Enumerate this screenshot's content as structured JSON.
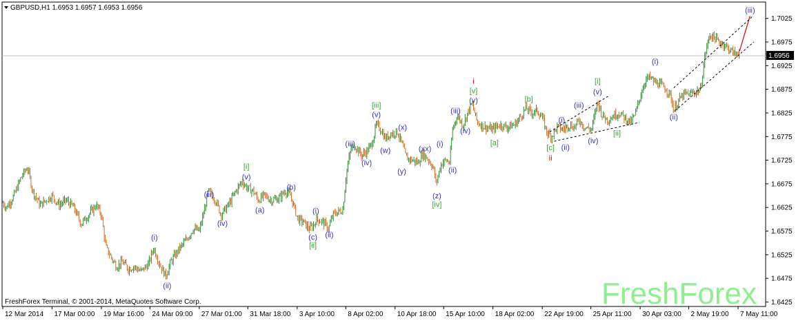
{
  "header": {
    "symbol_line": "GBPUSD,H1  1.6953 1.6957 1.6953 1.6956",
    "menu_arrow_icon": "triangle-down-icon"
  },
  "footer": {
    "copyright": "FreshForex Terminal, © 2001-2014, MetaQuotes Software Corp.",
    "watermark": "FreshForex"
  },
  "colors": {
    "background": "#ffffff",
    "axes": "#000000",
    "bull_candle": "#2e8b2e",
    "bear_candle": "#d2691e",
    "wave_blue": "#3333cc",
    "wave_green": "#33aa33",
    "wave_red": "#dd0000",
    "watermark": "#90ee90",
    "price_line": "#c0c0c0",
    "price_label_bg": "#000000",
    "price_label_fg": "#ffffff"
  },
  "chart_data": {
    "type": "candlestick",
    "symbol": "GBPUSD",
    "timeframe": "H1",
    "ohlc_current": {
      "open": 1.6953,
      "high": 1.6957,
      "low": 1.6953,
      "close": 1.6956
    },
    "current_price_label": "1.6956",
    "current_price": 1.6956,
    "ylim": [
      1.6417,
      1.7058
    ],
    "y_ticks": [
      {
        "value": 1.7025,
        "label": "1.7025"
      },
      {
        "value": 1.6975,
        "label": "1.6975"
      },
      {
        "value": 1.6925,
        "label": "1.6925"
      },
      {
        "value": 1.6875,
        "label": "1.6875"
      },
      {
        "value": 1.6825,
        "label": "1.6825"
      },
      {
        "value": 1.6775,
        "label": "1.6775"
      },
      {
        "value": 1.6725,
        "label": "1.6725"
      },
      {
        "value": 1.6675,
        "label": "1.6675"
      },
      {
        "value": 1.6625,
        "label": "1.6625"
      },
      {
        "value": 1.6575,
        "label": "1.6575"
      },
      {
        "value": 1.6525,
        "label": "1.6525"
      },
      {
        "value": 1.6475,
        "label": "1.6475"
      },
      {
        "value": 1.6425,
        "label": "1.6425"
      }
    ],
    "x_ticks": [
      {
        "idx": 0,
        "label": "12 Mar 2014"
      },
      {
        "idx": 66,
        "label": "17 Mar 00:00"
      },
      {
        "idx": 132,
        "label": "19 Mar 16:00"
      },
      {
        "idx": 197,
        "label": "24 Mar 09:00"
      },
      {
        "idx": 263,
        "label": "27 Mar 01:00"
      },
      {
        "idx": 328,
        "label": "31 Mar 18:00"
      },
      {
        "idx": 394,
        "label": "3 Apr 10:00"
      },
      {
        "idx": 459,
        "label": "8 Apr 02:00"
      },
      {
        "idx": 525,
        "label": "10 Apr 18:00"
      },
      {
        "idx": 590,
        "label": "15 Apr 10:00"
      },
      {
        "idx": 656,
        "label": "18 Apr 02:00"
      },
      {
        "idx": 722,
        "label": "22 Apr 19:00"
      },
      {
        "idx": 787,
        "label": "25 Apr 11:00"
      },
      {
        "idx": 853,
        "label": "30 Apr 03:00"
      },
      {
        "idx": 918,
        "label": "2 May 19:00"
      },
      {
        "idx": 984,
        "label": "7 May 11:00"
      }
    ],
    "price_path": [
      [
        0,
        1.6635
      ],
      [
        5,
        1.6625
      ],
      [
        15,
        1.665
      ],
      [
        25,
        1.669
      ],
      [
        33,
        1.671
      ],
      [
        40,
        1.666
      ],
      [
        50,
        1.663
      ],
      [
        58,
        1.664
      ],
      [
        66,
        1.665
      ],
      [
        75,
        1.663
      ],
      [
        85,
        1.664
      ],
      [
        95,
        1.6625
      ],
      [
        105,
        1.659
      ],
      [
        115,
        1.661
      ],
      [
        125,
        1.663
      ],
      [
        132,
        1.661
      ],
      [
        138,
        1.654
      ],
      [
        145,
        1.652
      ],
      [
        152,
        1.65
      ],
      [
        160,
        1.651
      ],
      [
        168,
        1.6495
      ],
      [
        175,
        1.65
      ],
      [
        185,
        1.649
      ],
      [
        195,
        1.6505
      ],
      [
        202,
        1.654
      ],
      [
        210,
        1.6505
      ],
      [
        218,
        1.648
      ],
      [
        225,
        1.651
      ],
      [
        235,
        1.6535
      ],
      [
        245,
        1.6555
      ],
      [
        255,
        1.658
      ],
      [
        263,
        1.6575
      ],
      [
        270,
        1.662
      ],
      [
        275,
        1.666
      ],
      [
        285,
        1.664
      ],
      [
        292,
        1.661
      ],
      [
        302,
        1.663
      ],
      [
        312,
        1.666
      ],
      [
        320,
        1.668
      ],
      [
        328,
        1.6665
      ],
      [
        335,
        1.666
      ],
      [
        342,
        1.664
      ],
      [
        350,
        1.665
      ],
      [
        360,
        1.664
      ],
      [
        370,
        1.6645
      ],
      [
        378,
        1.666
      ],
      [
        385,
        1.665
      ],
      [
        390,
        1.6625
      ],
      [
        395,
        1.66
      ],
      [
        402,
        1.6595
      ],
      [
        410,
        1.658
      ],
      [
        415,
        1.6585
      ],
      [
        420,
        1.66
      ],
      [
        428,
        1.6595
      ],
      [
        436,
        1.658
      ],
      [
        442,
        1.661
      ],
      [
        448,
        1.6615
      ],
      [
        455,
        1.662
      ],
      [
        460,
        1.67
      ],
      [
        466,
        1.675
      ],
      [
        472,
        1.6755
      ],
      [
        480,
        1.6735
      ],
      [
        488,
        1.6745
      ],
      [
        494,
        1.676
      ],
      [
        500,
        1.68
      ],
      [
        506,
        1.679
      ],
      [
        512,
        1.677
      ],
      [
        518,
        1.678
      ],
      [
        528,
        1.6785
      ],
      [
        534,
        1.676
      ],
      [
        540,
        1.673
      ],
      [
        548,
        1.6725
      ],
      [
        556,
        1.672
      ],
      [
        562,
        1.674
      ],
      [
        570,
        1.6725
      ],
      [
        576,
        1.671
      ],
      [
        580,
        1.6675
      ],
      [
        586,
        1.6715
      ],
      [
        592,
        1.6725
      ],
      [
        598,
        1.672
      ],
      [
        602,
        1.679
      ],
      [
        608,
        1.682
      ],
      [
        616,
        1.68
      ],
      [
        622,
        1.6825
      ],
      [
        628,
        1.6845
      ],
      [
        635,
        1.6805
      ],
      [
        645,
        1.6795
      ],
      [
        655,
        1.679
      ],
      [
        665,
        1.68
      ],
      [
        675,
        1.6795
      ],
      [
        685,
        1.68
      ],
      [
        692,
        1.6815
      ],
      [
        700,
        1.6835
      ],
      [
        708,
        1.6825
      ],
      [
        715,
        1.683
      ],
      [
        722,
        1.6815
      ],
      [
        728,
        1.6785
      ],
      [
        734,
        1.6775
      ],
      [
        742,
        1.6795
      ],
      [
        750,
        1.679
      ],
      [
        758,
        1.68
      ],
      [
        765,
        1.6795
      ],
      [
        772,
        1.681
      ],
      [
        778,
        1.6795
      ],
      [
        788,
        1.679
      ],
      [
        796,
        1.685
      ],
      [
        802,
        1.682
      ],
      [
        810,
        1.681
      ],
      [
        818,
        1.682
      ],
      [
        825,
        1.6825
      ],
      [
        832,
        1.6815
      ],
      [
        840,
        1.6805
      ],
      [
        846,
        1.682
      ],
      [
        853,
        1.686
      ],
      [
        860,
        1.6895
      ],
      [
        866,
        1.69
      ],
      [
        872,
        1.689
      ],
      [
        880,
        1.6885
      ],
      [
        888,
        1.6875
      ],
      [
        894,
        1.686
      ],
      [
        898,
        1.683
      ],
      [
        904,
        1.685
      ],
      [
        912,
        1.6865
      ],
      [
        920,
        1.6865
      ],
      [
        928,
        1.687
      ],
      [
        934,
        1.6875
      ],
      [
        940,
        1.695
      ],
      [
        946,
        1.699
      ],
      [
        952,
        1.6985
      ],
      [
        958,
        1.6975
      ],
      [
        965,
        1.697
      ],
      [
        972,
        1.696
      ],
      [
        980,
        1.695
      ],
      [
        986,
        1.6956
      ]
    ],
    "forecast_segment": [
      [
        986,
        1.6956
      ],
      [
        1000,
        1.703
      ]
    ],
    "channel_lines": [
      [
        [
          732,
          1.6785
        ],
        [
          812,
          1.6862
        ]
      ],
      [
        [
          738,
          1.6765
        ],
        [
          852,
          1.6805
        ]
      ],
      [
        [
          898,
          1.6878
        ],
        [
          1004,
          1.703
        ]
      ],
      [
        [
          900,
          1.683
        ],
        [
          1005,
          1.6975
        ]
      ]
    ],
    "wave_labels": [
      {
        "t": "[i]",
        "idx": 326,
        "p": 1.6712,
        "c": "green"
      },
      {
        "t": "(v)",
        "idx": 326,
        "p": 1.669,
        "c": "blue"
      },
      {
        "t": "(iii)",
        "idx": 276,
        "p": 1.6653,
        "c": "blue"
      },
      {
        "t": "(iv)",
        "idx": 294,
        "p": 1.6592,
        "c": "blue"
      },
      {
        "t": "(b)",
        "idx": 386,
        "p": 1.6668,
        "c": "blue"
      },
      {
        "t": "(a)",
        "idx": 344,
        "p": 1.662,
        "c": "blue"
      },
      {
        "t": "(c)",
        "idx": 415,
        "p": 1.6563,
        "c": "blue"
      },
      {
        "t": "[ii]",
        "idx": 415,
        "p": 1.6545,
        "c": "green"
      },
      {
        "t": "(i)",
        "idx": 419,
        "p": 1.6618,
        "c": "blue"
      },
      {
        "t": "(ii)",
        "idx": 437,
        "p": 1.6568,
        "c": "blue"
      },
      {
        "t": "(i)",
        "idx": 203,
        "p": 1.6562,
        "c": "blue"
      },
      {
        "t": "(ii)",
        "idx": 220,
        "p": 1.646,
        "c": "blue"
      },
      {
        "t": "[iii]",
        "idx": 500,
        "p": 1.6842,
        "c": "green"
      },
      {
        "t": "(v)",
        "idx": 500,
        "p": 1.6822,
        "c": "blue"
      },
      {
        "t": "(iii)",
        "idx": 465,
        "p": 1.676,
        "c": "blue"
      },
      {
        "t": "(iv)",
        "idx": 487,
        "p": 1.672,
        "c": "blue"
      },
      {
        "t": "(w)",
        "idx": 512,
        "p": 1.6746,
        "c": "blue"
      },
      {
        "t": "(x)",
        "idx": 535,
        "p": 1.6795,
        "c": "blue"
      },
      {
        "t": "(y)",
        "idx": 534,
        "p": 1.6702,
        "c": "blue"
      },
      {
        "t": "(xx)",
        "idx": 565,
        "p": 1.675,
        "c": "blue"
      },
      {
        "t": "(i)",
        "idx": 585,
        "p": 1.676,
        "c": "blue"
      },
      {
        "t": "(z)",
        "idx": 581,
        "p": 1.665,
        "c": "blue"
      },
      {
        "t": "[iv]",
        "idx": 581,
        "p": 1.6632,
        "c": "green"
      },
      {
        "t": "(ii)",
        "idx": 602,
        "p": 1.6705,
        "c": "blue"
      },
      {
        "t": "(iii)",
        "idx": 606,
        "p": 1.683,
        "c": "blue"
      },
      {
        "t": "(iv)",
        "idx": 619,
        "p": 1.6788,
        "c": "blue"
      },
      {
        "t": "i",
        "idx": 630,
        "p": 1.6893,
        "c": "red"
      },
      {
        "t": "[v]",
        "idx": 630,
        "p": 1.6872,
        "c": "green"
      },
      {
        "t": "(v)",
        "idx": 630,
        "p": 1.6852,
        "c": "blue"
      },
      {
        "t": "[a]",
        "idx": 658,
        "p": 1.6762,
        "c": "green"
      },
      {
        "t": "[b]",
        "idx": 704,
        "p": 1.6855,
        "c": "green"
      },
      {
        "t": "[c]",
        "idx": 733,
        "p": 1.6752,
        "c": "green"
      },
      {
        "t": "ii",
        "idx": 733,
        "p": 1.673,
        "c": "red"
      },
      {
        "t": "(i)",
        "idx": 748,
        "p": 1.681,
        "c": "blue"
      },
      {
        "t": "(ii)",
        "idx": 753,
        "p": 1.6753,
        "c": "blue"
      },
      {
        "t": "(iii)",
        "idx": 771,
        "p": 1.6842,
        "c": "blue"
      },
      {
        "t": "(iv)",
        "idx": 790,
        "p": 1.6767,
        "c": "blue"
      },
      {
        "t": "[i]",
        "idx": 796,
        "p": 1.6893,
        "c": "green"
      },
      {
        "t": "(v)",
        "idx": 796,
        "p": 1.687,
        "c": "blue"
      },
      {
        "t": "[ii]",
        "idx": 822,
        "p": 1.6783,
        "c": "green"
      },
      {
        "t": "(i)",
        "idx": 873,
        "p": 1.6934,
        "c": "blue"
      },
      {
        "t": "(ii)",
        "idx": 898,
        "p": 1.6817,
        "c": "blue"
      },
      {
        "t": "(iii)",
        "idx": 1000,
        "p": 1.7043,
        "c": "blue"
      }
    ]
  }
}
